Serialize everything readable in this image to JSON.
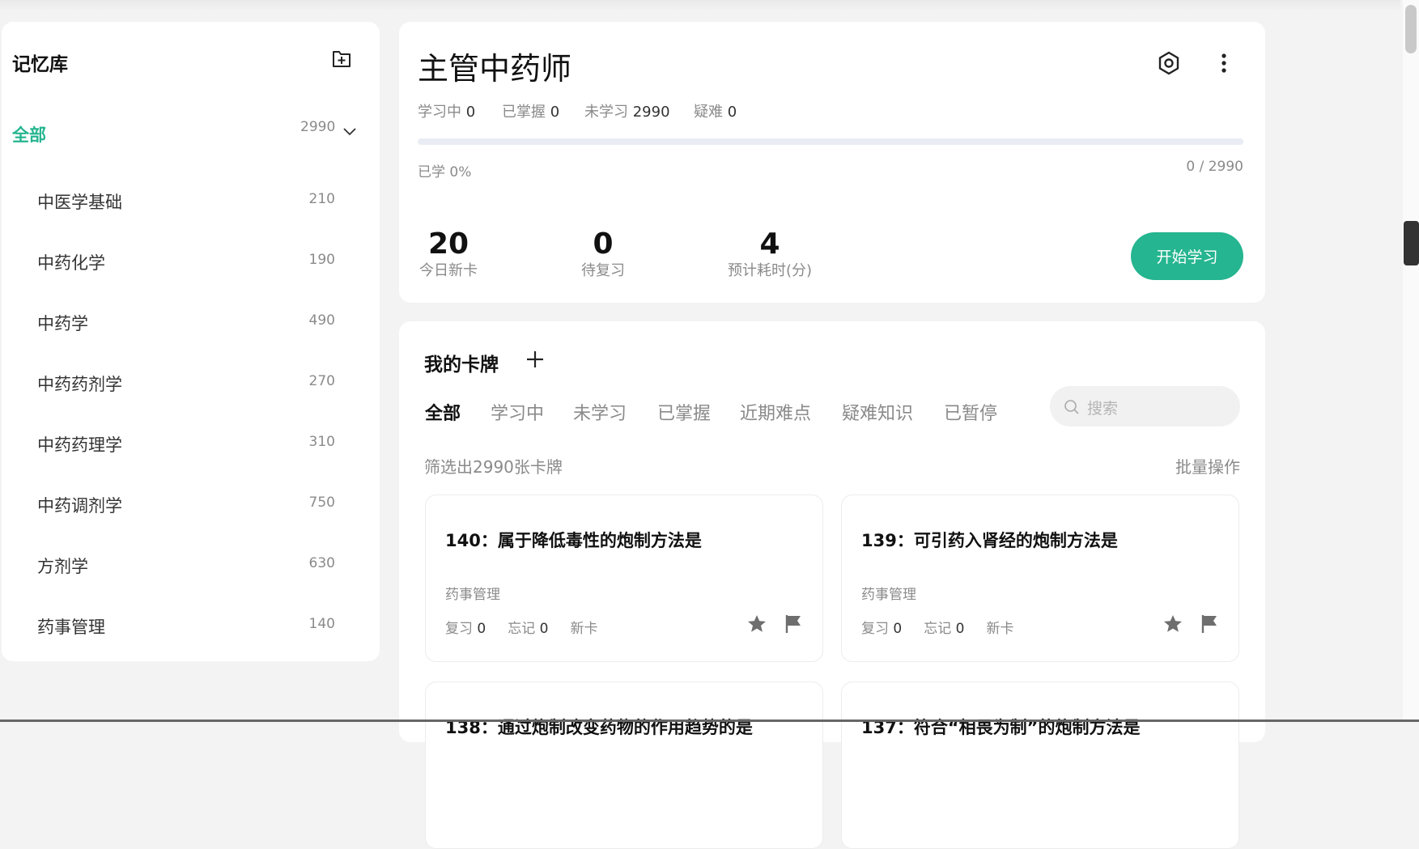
{
  "sidebar": {
    "title": "记忆库",
    "all": {
      "label": "全部",
      "count": "2990"
    },
    "items": [
      {
        "label": "中医学基础",
        "count": "210"
      },
      {
        "label": "中药化学",
        "count": "190"
      },
      {
        "label": "中药学",
        "count": "490"
      },
      {
        "label": "中药药剂学",
        "count": "270"
      },
      {
        "label": "中药药理学",
        "count": "310"
      },
      {
        "label": "中药调剂学",
        "count": "750"
      },
      {
        "label": "方剂学",
        "count": "630"
      },
      {
        "label": "药事管理",
        "count": "140"
      }
    ]
  },
  "deck": {
    "title": "主管中药师",
    "stats": [
      {
        "label": "学习中",
        "value": "0"
      },
      {
        "label": "已掌握",
        "value": "0"
      },
      {
        "label": "未学习",
        "value": "2990"
      },
      {
        "label": "疑难",
        "value": "0"
      }
    ],
    "progress": 0,
    "learned_text": "已学 0%",
    "learned_count": "0 / 2990",
    "kpis": [
      {
        "value": "20",
        "label": "今日新卡"
      },
      {
        "value": "0",
        "label": "待复习"
      },
      {
        "value": "4",
        "label": "预计耗时(分)"
      }
    ],
    "start_label": "开始学习"
  },
  "cards_section": {
    "title": "我的卡牌",
    "tabs": [
      "全部",
      "学习中",
      "未学习",
      "已掌握",
      "近期难点",
      "疑难知识",
      "已暂停"
    ],
    "active_tab": "全部",
    "search_placeholder": "搜索",
    "filter_text": "筛选出2990张卡牌",
    "batch_label": "批量操作",
    "cards": [
      {
        "title": "140：属于降低毒性的炮制方法是",
        "category": "药事管理",
        "review_label": "复习",
        "review": "0",
        "forget_label": "忘记",
        "forget": "0",
        "status": "新卡"
      },
      {
        "title": "139：可引药入肾经的炮制方法是",
        "category": "药事管理",
        "review_label": "复习",
        "review": "0",
        "forget_label": "忘记",
        "forget": "0",
        "status": "新卡"
      },
      {
        "title": "138：通过炮制改变药物的作用趋势的是",
        "category": "",
        "review_label": "",
        "review": "",
        "forget_label": "",
        "forget": "",
        "status": ""
      },
      {
        "title": "137：符合“相畏为制”的炮制方法是",
        "category": "",
        "review_label": "",
        "review": "",
        "forget_label": "",
        "forget": "",
        "status": ""
      }
    ]
  },
  "colors": {
    "accent": "#25b590",
    "background": "#f3f3f3",
    "muted": "#8a8a8a"
  },
  "icons": [
    "add-folder-icon",
    "chevron-down-icon",
    "settings-icon",
    "more-icon",
    "plus-icon",
    "search-icon",
    "star-icon",
    "flag-icon"
  ]
}
